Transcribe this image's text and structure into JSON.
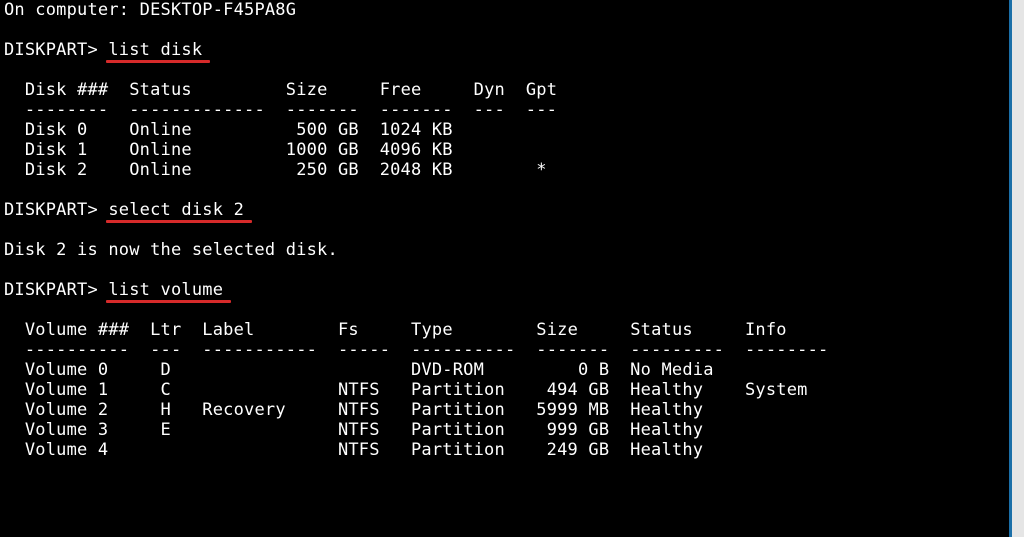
{
  "header": {
    "copyright_fragment": "On computer: ",
    "computer_name": "DESKTOP-F45PA8G"
  },
  "prompt": "DISKPART>",
  "commands": {
    "list_disk": "list disk",
    "select_disk": "select disk 2",
    "list_volume": "list volume"
  },
  "disk_table": {
    "headers": {
      "disk": "Disk ###",
      "status": "Status",
      "size": "Size",
      "free": "Free",
      "dyn": "Dyn",
      "gpt": "Gpt"
    },
    "rules": {
      "disk": "--------",
      "status": "-------------",
      "size": "-------",
      "free": "-------",
      "dyn": "---",
      "gpt": "---"
    },
    "rows": [
      {
        "disk": "Disk 0",
        "status": "Online",
        "size": "500 GB",
        "free": "1024 KB",
        "dyn": "",
        "gpt": ""
      },
      {
        "disk": "Disk 1",
        "status": "Online",
        "size": "1000 GB",
        "free": "4096 KB",
        "dyn": "",
        "gpt": ""
      },
      {
        "disk": "Disk 2",
        "status": "Online",
        "size": "250 GB",
        "free": "2048 KB",
        "dyn": "",
        "gpt": "*"
      }
    ]
  },
  "select_result": "Disk 2 is now the selected disk.",
  "volume_table": {
    "headers": {
      "vol": "Volume ###",
      "ltr": "Ltr",
      "label": "Label",
      "fs": "Fs",
      "type": "Type",
      "size": "Size",
      "status": "Status",
      "info": "Info"
    },
    "rules": {
      "vol": "----------",
      "ltr": "---",
      "label": "-----------",
      "fs": "-----",
      "type": "----------",
      "size": "-------",
      "status": "---------",
      "info": "--------"
    },
    "rows": [
      {
        "vol": "Volume 0",
        "ltr": "D",
        "label": "",
        "fs": "",
        "type": "DVD-ROM",
        "size": "0 B",
        "status": "No Media",
        "info": ""
      },
      {
        "vol": "Volume 1",
        "ltr": "C",
        "label": "",
        "fs": "NTFS",
        "type": "Partition",
        "size": "494 GB",
        "status": "Healthy",
        "info": "System"
      },
      {
        "vol": "Volume 2",
        "ltr": "H",
        "label": "Recovery",
        "fs": "NTFS",
        "type": "Partition",
        "size": "5999 MB",
        "status": "Healthy",
        "info": ""
      },
      {
        "vol": "Volume 3",
        "ltr": "E",
        "label": "",
        "fs": "NTFS",
        "type": "Partition",
        "size": "999 GB",
        "status": "Healthy",
        "info": ""
      },
      {
        "vol": "Volume 4",
        "ltr": "",
        "label": "",
        "fs": "NTFS",
        "type": "Partition",
        "size": "249 GB",
        "status": "Healthy",
        "info": ""
      }
    ]
  }
}
